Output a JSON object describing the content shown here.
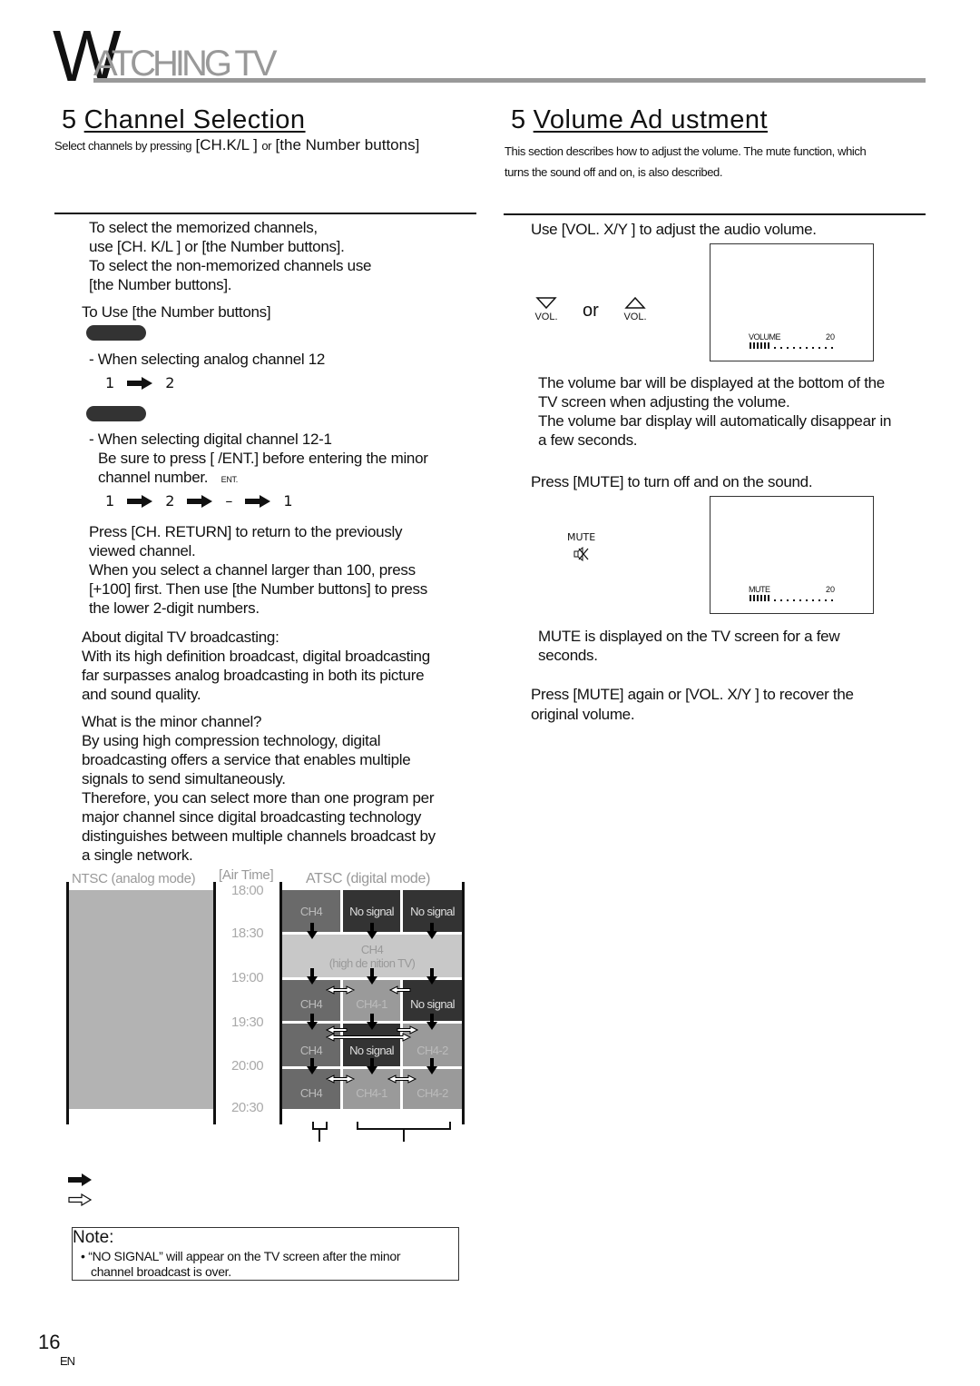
{
  "header": {
    "initial": "W",
    "rest": "ATCHING TV"
  },
  "channel_selection": {
    "number": "5",
    "title": "Channel Selection",
    "intro_small": "Select channels by pressing",
    "intro_key1": "[CH.K/L ]",
    "intro_or": "or",
    "intro_key2": "[the Number buttons]",
    "paragraph1": [
      "To select the memorized channels,",
      "use [CH. K/L ] or [the Number buttons].",
      "To select the non-memorized channels use",
      "[the Number buttons]."
    ],
    "number_buttons_heading": "To Use [the Number buttons]",
    "analog_label": "- When selecting analog channel 12",
    "analog_sequence": [
      "1",
      "2"
    ],
    "digital_label": "- When selecting digital channel 12-1",
    "digital_note_1": "Be sure to press [   /ENT.] before entering the minor",
    "digital_note_2": "channel number.",
    "ent_label": "ENT.",
    "digital_sequence": [
      "1",
      "2",
      "–",
      "1"
    ],
    "paragraph2": [
      "Press [CH. RETURN] to return to the previously",
      "viewed channel.",
      "When you select a channel larger than 100, press",
      "[+100] first. Then use [the Number buttons] to press",
      "the lower 2-digit numbers."
    ],
    "about_heading": "About digital TV broadcasting:",
    "about_body": [
      "With its high definition broadcast, digital broadcasting",
      "far surpasses analog broadcasting in both its picture",
      "and sound quality."
    ],
    "minor_heading": "What is the minor channel?",
    "minor_body": [
      "By using high compression technology, digital",
      "broadcasting offers a service that enables multiple",
      "signals to send simultaneously.",
      "Therefore, you can select more than one program per",
      "major channel since digital broadcasting technology",
      "distinguishes between multiple channels broadcast by",
      "a single network."
    ]
  },
  "diagram": {
    "ntsc_label": "NTSC (analog mode)",
    "air_time_label": "[Air Time]",
    "atsc_label": "ATSC (digital mode)",
    "times": [
      "18:00",
      "18:30",
      "19:00",
      "19:30",
      "20:00",
      "20:30"
    ],
    "rows": [
      [
        "CH4",
        "No signal",
        "No signal"
      ],
      [
        "CH4",
        "(high de  nition TV)"
      ],
      [
        "CH4",
        "CH4-1",
        "No signal"
      ],
      [
        "CH4",
        "No signal",
        "CH4-2"
      ],
      [
        "CH4",
        "CH4-1",
        "CH4-2"
      ]
    ],
    "colors": {
      "analog_fill": "#b3b3b3",
      "mid": "#6a6a6a",
      "dark": "#333333",
      "light": "#c8c8c8",
      "grey": "#9a9a9a"
    }
  },
  "legend": {
    "solid_arrow": "",
    "outline_arrow": ""
  },
  "note": {
    "title": "Note:",
    "bullet": "•",
    "text_1": "“NO SIGNAL” will appear on the TV screen after the minor",
    "text_2": "channel broadcast is over."
  },
  "volume_adjustment": {
    "number": "5",
    "title": "Volume Ad ustment",
    "intro": [
      "This section describes how to adjust the volume. The mute function, which",
      "turns the sound off and on, is also described."
    ],
    "step1": "Use [VOL. X/Y ] to adjust the audio volume.",
    "vol_label": "VOL.",
    "or_label": "or",
    "osd_volume_label": "VOLUME",
    "osd_volume_value": "20",
    "volume_level": 20,
    "volume_segments_filled": 6,
    "volume_segments_total": 16,
    "step1_notes": [
      "The volume bar will be displayed at the bottom of the",
      "TV screen when adjusting the volume.",
      "The volume bar display will automatically disappear in",
      "a few seconds."
    ],
    "step2": "Press [MUTE] to turn off and on the sound.",
    "mute_button_label": "MUTE",
    "osd_mute_label": "MUTE",
    "osd_mute_value": "20",
    "step2_notes": [
      " MUTE  is displayed on the TV screen for a few",
      "seconds."
    ],
    "step3": [
      "Press [MUTE] again or [VOL. X/Y ] to recover the",
      "original volume."
    ]
  },
  "footer": {
    "page_number": "16",
    "language": "EN"
  }
}
